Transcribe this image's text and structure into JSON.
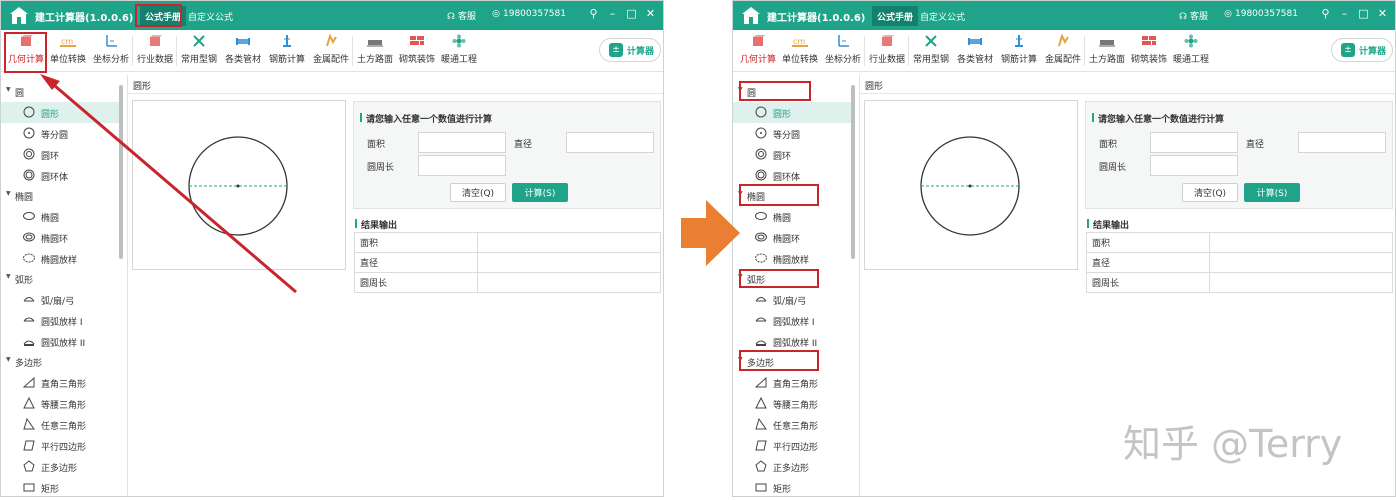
{
  "app_name": "建工计算器(1.0.0.6)",
  "top_tabs": [
    "公式手册",
    "自定义公式"
  ],
  "service_label": "客服",
  "phone": "19800357581",
  "window_buttons": [
    "pin",
    "minimize",
    "maximize",
    "close"
  ],
  "toolbar": [
    {
      "label": "几何计算",
      "icon": "cube-icon",
      "color": "#e45656"
    },
    {
      "label": "单位转换",
      "icon": "unit-cm-icon",
      "color": "#e8a33d"
    },
    {
      "label": "坐标分析",
      "icon": "axis-icon",
      "color": "#2f8fd8"
    },
    {
      "label": "行业数据",
      "icon": "data-cube-icon",
      "color": "#e45656"
    },
    {
      "label": "常用型钢",
      "icon": "tools-icon",
      "color": "#1fa48a"
    },
    {
      "label": "各类管材",
      "icon": "pipe-icon",
      "color": "#2f8fd8"
    },
    {
      "label": "钢筋计算",
      "icon": "rebar-icon",
      "color": "#2f8fd8"
    },
    {
      "label": "金属配件",
      "icon": "fitting-icon",
      "color": "#e8a33d"
    },
    {
      "label": "土方路面",
      "icon": "earthwork-icon",
      "color": "#777777"
    },
    {
      "label": "砌筑装饰",
      "icon": "brick-icon",
      "color": "#e45656"
    },
    {
      "label": "暖通工程",
      "icon": "hvac-icon",
      "color": "#1fa48a"
    }
  ],
  "calculator_button": "计算器",
  "sidebar": [
    {
      "group": "圆",
      "items": [
        "圆形",
        "等分圆",
        "圆环",
        "圆环体"
      ]
    },
    {
      "group": "椭圆",
      "items": [
        "椭圆",
        "椭圆环",
        "椭圆放样"
      ]
    },
    {
      "group": "弧形",
      "items": [
        "弧/扇/弓",
        "圆弧放样 I",
        "圆弧放样 II"
      ]
    },
    {
      "group": "多边形",
      "items": [
        "直角三角形",
        "等腰三角形",
        "任意三角形",
        "平行四边形",
        "正多边形",
        "矩形"
      ]
    }
  ],
  "selected_item": "圆形",
  "content_title": "圆形",
  "input_section_title": "请您输入任意一个数值进行计算",
  "fields": {
    "area": "面积",
    "diameter": "直径",
    "circumference": "圆周长"
  },
  "buttons": {
    "clear": "清空(Q)",
    "calculate": "计算(S)"
  },
  "result_section_title": "结果输出",
  "result_rows": [
    "面积",
    "直径",
    "圆周长"
  ],
  "watermark": "知乎 @Terry",
  "colors": {
    "brand_teal": "#1fa48a",
    "annotation_red": "#c8252d",
    "arrow_orange": "#ea7f34"
  }
}
